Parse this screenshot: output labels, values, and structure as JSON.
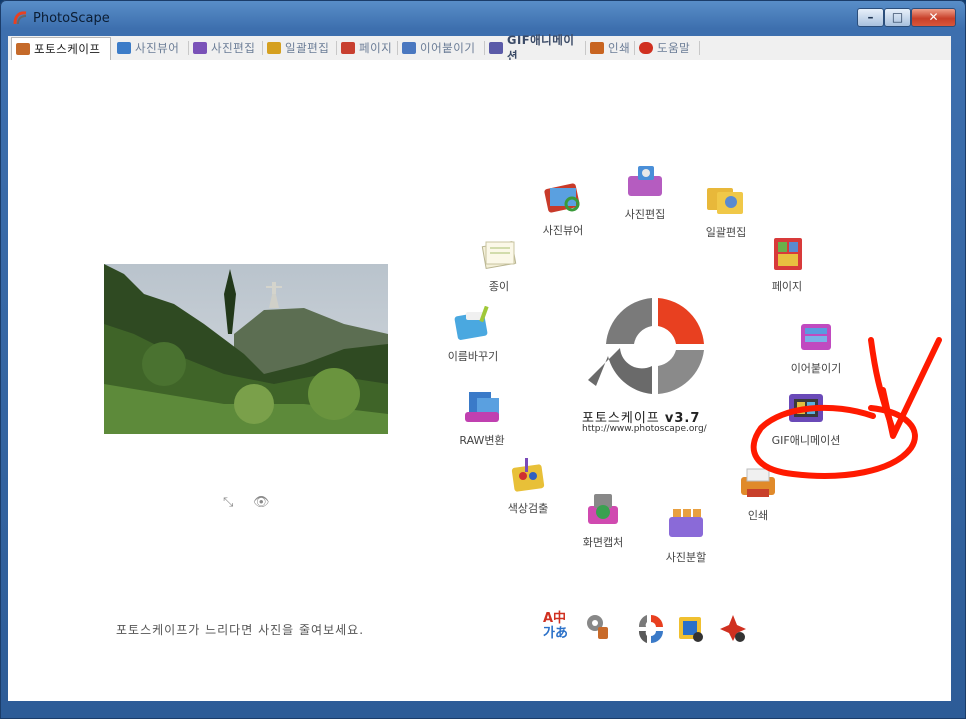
{
  "window": {
    "title": "PhotoScape"
  },
  "tabs": [
    {
      "label": "포토스케이프",
      "icon": "home-icon",
      "color": "#c56a2a",
      "active": true
    },
    {
      "label": "사진뷰어",
      "icon": "viewer-icon",
      "color": "#3c7cc8"
    },
    {
      "label": "사진편집",
      "icon": "editor-icon",
      "color": "#7a52b8"
    },
    {
      "label": "일괄편집",
      "icon": "batch-icon",
      "color": "#d5a020"
    },
    {
      "label": "페이지",
      "icon": "page-icon",
      "color": "#c84030"
    },
    {
      "label": "이어붙이기",
      "icon": "combine-icon",
      "color": "#4a78c0"
    },
    {
      "label": "GIF애니메이션",
      "icon": "gif-icon",
      "color": "#5a5aa8"
    },
    {
      "label": "인쇄",
      "icon": "print-icon",
      "color": "#c86420"
    },
    {
      "label": "도움말",
      "icon": "help-icon",
      "color": "#d03020"
    }
  ],
  "home": {
    "hint": "포토스케이프가 느리다면 사진을 줄여보세요.",
    "small_controls": [
      "zoom-icon",
      "eye-icon"
    ],
    "logo": {
      "name": "포토스케이프",
      "version": "v3.7",
      "url": "http://www.photoscape.org/"
    },
    "menu": [
      {
        "label": "사진편집",
        "icon": "editor-icon"
      },
      {
        "label": "일괄편집",
        "icon": "batch-icon"
      },
      {
        "label": "페이지",
        "icon": "page-icon"
      },
      {
        "label": "이어붙이기",
        "icon": "combine-icon"
      },
      {
        "label": "GIF애니메이션",
        "icon": "gif-icon"
      },
      {
        "label": "인쇄",
        "icon": "print-icon"
      },
      {
        "label": "사진분할",
        "icon": "splitter-icon"
      },
      {
        "label": "화면캡처",
        "icon": "screen-capture-icon"
      },
      {
        "label": "색상검출",
        "icon": "color-picker-icon"
      },
      {
        "label": "RAW변환",
        "icon": "raw-converter-icon"
      },
      {
        "label": "이름바꾸기",
        "icon": "rename-icon"
      },
      {
        "label": "종이",
        "icon": "paper-icon"
      },
      {
        "label": "사진뷰어",
        "icon": "viewer-icon"
      }
    ],
    "bottom_icons": [
      "language-icon",
      "tools-icon",
      "photoscape-x-icon",
      "photo-icon",
      "game-icon"
    ],
    "language_glyphs": {
      "top": "A中",
      "bottom": "가あ"
    }
  },
  "colors": {
    "logo_red": "#e84020",
    "logo_gray": "#6a6a6a",
    "annotation_red": "#ff1a00"
  }
}
